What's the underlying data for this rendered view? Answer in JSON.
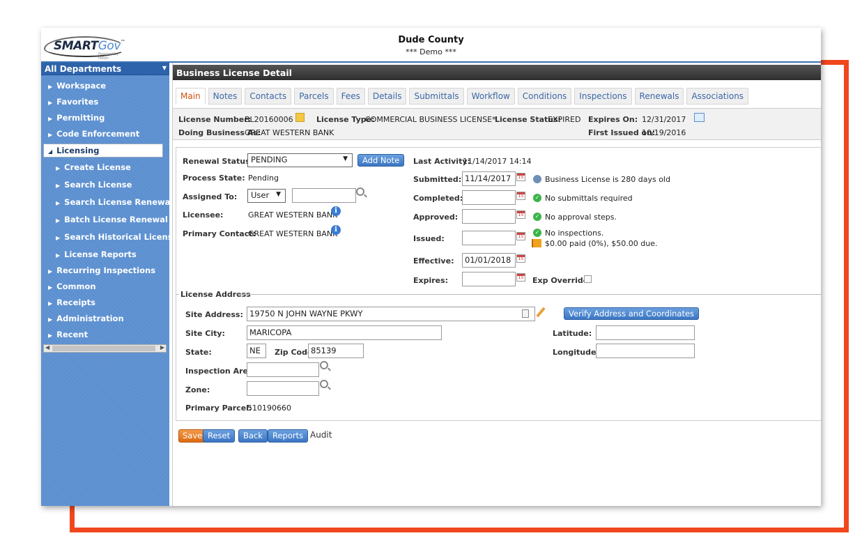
{
  "header": {
    "logo_brand": "SMART",
    "logo_brand_suffix": "Gov",
    "logo_tm": "™",
    "logo_tagline": "Powered by Pekeh",
    "org_name": "Dude County",
    "org_subtitle": "*** Demo ***"
  },
  "sidebar": {
    "department": "All Departments",
    "items": [
      {
        "label": "Workspace"
      },
      {
        "label": "Favorites"
      },
      {
        "label": "Permitting"
      },
      {
        "label": "Code Enforcement"
      },
      {
        "label": "Licensing"
      },
      {
        "label": "Create License"
      },
      {
        "label": "Search License"
      },
      {
        "label": "Search License Renewals"
      },
      {
        "label": "Batch License Renewal"
      },
      {
        "label": "Search Historical Licenses"
      },
      {
        "label": "License Reports"
      },
      {
        "label": "Recurring Inspections"
      },
      {
        "label": "Common"
      },
      {
        "label": "Receipts"
      },
      {
        "label": "Administration"
      },
      {
        "label": "Recent"
      }
    ]
  },
  "page": {
    "title": "Business License Detail"
  },
  "tabs": [
    "Main",
    "Notes",
    "Contacts",
    "Parcels",
    "Fees",
    "Details",
    "Submittals",
    "Workflow",
    "Conditions",
    "Inspections",
    "Renewals",
    "Associations"
  ],
  "summary": {
    "license_number_label": "License Number:",
    "license_number": "BL20160006",
    "license_type_label": "License Type:",
    "license_type": "COMMERCIAL BUSINESS LICENSE*",
    "license_status_label": "License Status:",
    "license_status": "EXPIRED",
    "expires_on_label": "Expires On:",
    "expires_on": "12/31/2017",
    "dba_label": "Doing Business As:",
    "dba": "GREAT WESTERN BANK",
    "first_issued_label": "First Issued on:",
    "first_issued": "10/19/2016"
  },
  "form": {
    "renewal_status_label": "Renewal Status:",
    "renewal_status": "PENDING",
    "add_note": "Add Note",
    "process_state_label": "Process State:",
    "process_state": "Pending",
    "assigned_to_label": "Assigned To:",
    "assigned_to_type": "User",
    "assigned_to_value": "",
    "licensee_label": "Licensee:",
    "licensee": "GREAT WESTERN BANK",
    "primary_contact_label": "Primary Contact:",
    "primary_contact": "GREAT WESTERN BANK",
    "last_activity_label": "Last Activity:",
    "last_activity": "11/14/2017 14:14",
    "submitted_label": "Submitted:",
    "submitted": "11/14/2017",
    "completed_label": "Completed:",
    "completed": "",
    "approved_label": "Approved:",
    "approved": "",
    "issued_label": "Issued:",
    "issued": "",
    "effective_label": "Effective:",
    "effective": "01/01/2018",
    "expires_label": "Expires:",
    "expires": "",
    "exp_override_label": "Exp Override:",
    "status_age": "Business License is 280 days old",
    "status_submittals": "No submittals required",
    "status_approval": "No approval steps.",
    "status_inspections": "No inspections.",
    "status_fees": "$0.00 paid (0%), $50.00 due."
  },
  "address": {
    "legend": "License Address",
    "site_address_label": "Site Address:",
    "site_address": "19750 N JOHN WAYNE PKWY",
    "verify_button": "Verify Address and Coordinates",
    "site_city_label": "Site City:",
    "site_city": "MARICOPA",
    "latitude_label": "Latitude:",
    "latitude": "",
    "state_label": "State:",
    "state": "NE",
    "zip_label": "Zip Code:",
    "zip": "85139",
    "longitude_label": "Longitude:",
    "longitude": "",
    "inspection_area_label": "Inspection Area:",
    "inspection_area": "",
    "zone_label": "Zone:",
    "zone": "",
    "primary_parcel_label": "Primary Parcel:",
    "primary_parcel": "510190660"
  },
  "actions": {
    "save": "Save",
    "reset": "Reset",
    "back": "Back",
    "reports": "Reports",
    "audit": "Audit"
  },
  "colors": {
    "accent_orange": "#f0471d",
    "nav_blue": "#5b8fd0",
    "button_blue": "#3b76c3"
  }
}
